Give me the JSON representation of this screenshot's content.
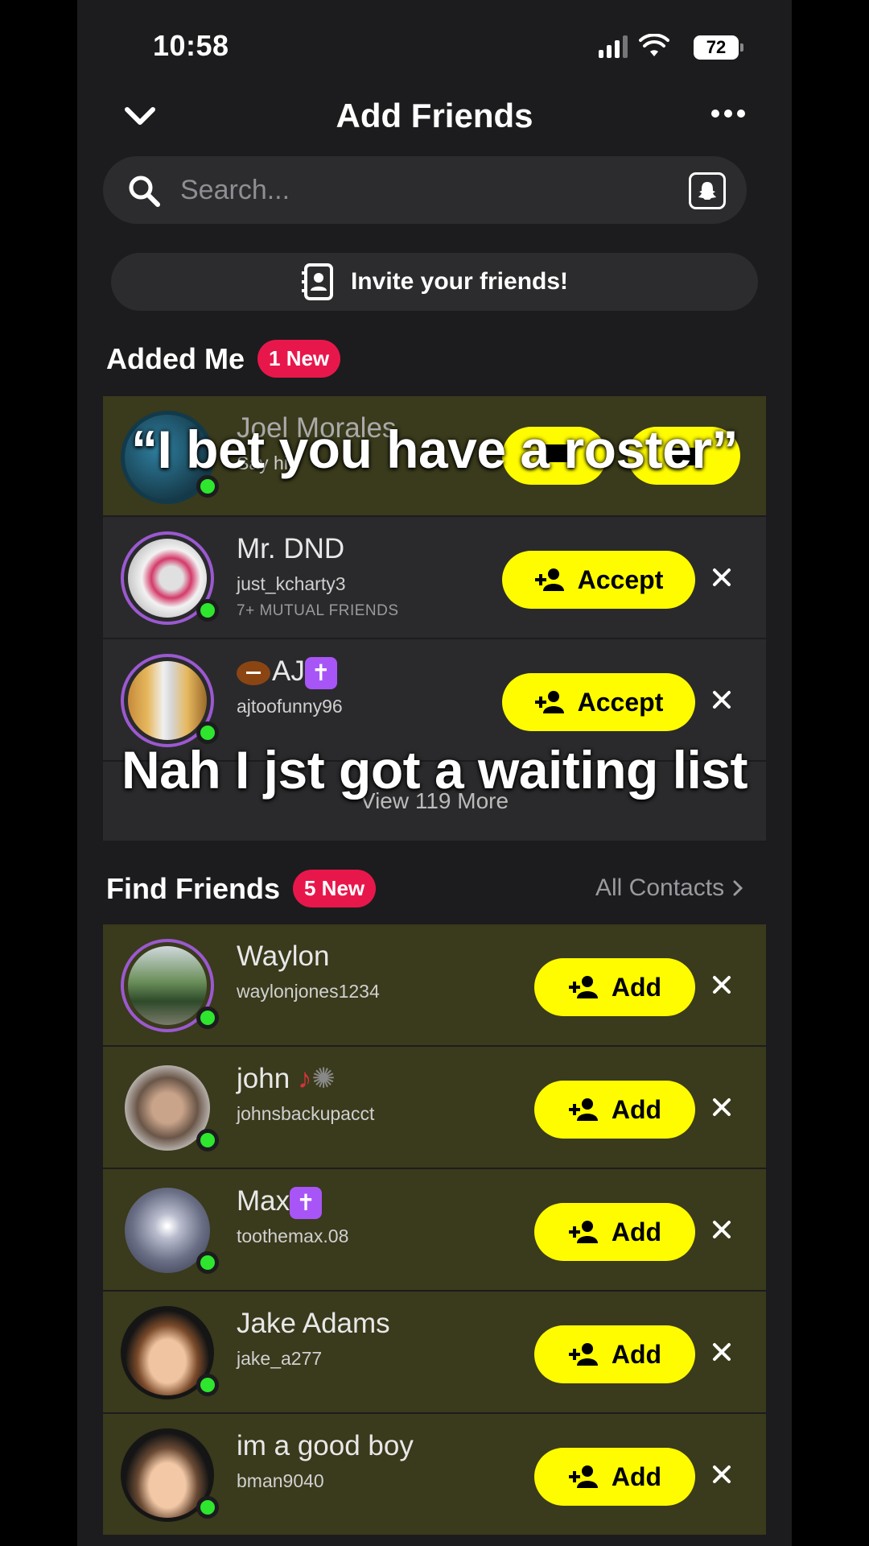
{
  "status": {
    "time": "10:58",
    "battery": "72"
  },
  "header": {
    "title": "Add Friends"
  },
  "search": {
    "placeholder": "Search..."
  },
  "invite": {
    "label": "Invite your friends!"
  },
  "added_me": {
    "title": "Added Me",
    "badge": "1 New",
    "rows": [
      {
        "name": "Joel Morales",
        "username": "Say hi!",
        "mutual": ""
      },
      {
        "name": "Mr. DND",
        "username": "just_kcharty3",
        "mutual": "7+ MUTUAL FRIENDS",
        "action": "Accept"
      },
      {
        "name": "AJ",
        "username": "ajtoofunny96",
        "mutual": "",
        "action": "Accept"
      }
    ],
    "view_more": "View 119 More"
  },
  "find_friends": {
    "title": "Find Friends",
    "badge": "5 New",
    "all_contacts": "All Contacts",
    "rows": [
      {
        "name": "Waylon",
        "username": "waylonjones1234",
        "action": "Add"
      },
      {
        "name": "john",
        "username": "johnsbackupacct",
        "action": "Add"
      },
      {
        "name": "Max",
        "username": "toothemax.08",
        "action": "Add"
      },
      {
        "name": "Jake Adams",
        "username": "jake_a277",
        "action": "Add"
      },
      {
        "name": "im a good boy",
        "username": "bman9040",
        "action": "Add"
      }
    ]
  },
  "captions": {
    "top": "“I bet you have a roster”",
    "bottom": "Nah I jst got a waiting list"
  },
  "colors": {
    "accent_yellow": "#fffc00",
    "badge_red": "#e8174b",
    "online_green": "#2ee62e",
    "ring_purple": "#9b59d0"
  }
}
